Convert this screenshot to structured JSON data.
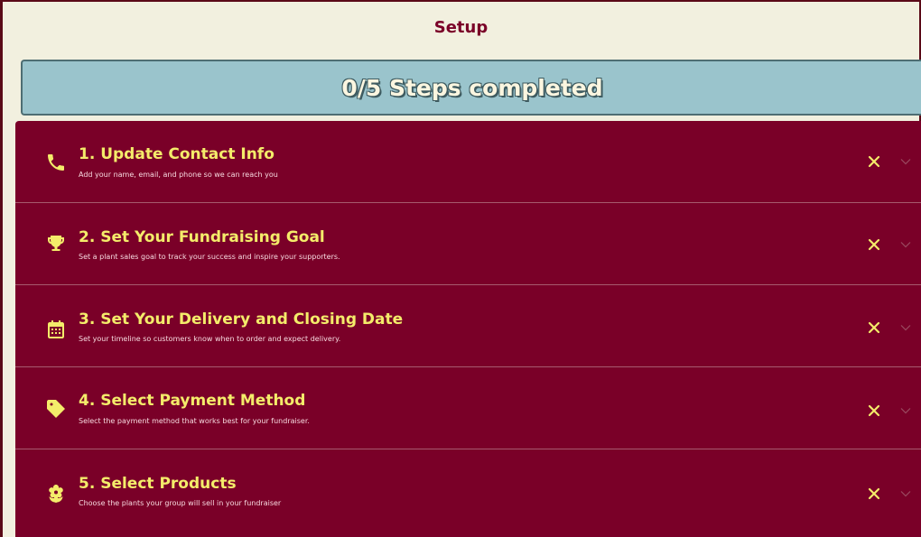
{
  "header": {
    "title": "Setup"
  },
  "progress": {
    "text": "0/5 Steps completed",
    "completed": 0,
    "total": 5
  },
  "steps": [
    {
      "title": "1. Update Contact Info",
      "description": "Add your name, email, and phone so we can reach you",
      "icon": "phone-icon"
    },
    {
      "title": "2. Set Your Fundraising Goal",
      "description": "Set a plant sales goal to track your success and inspire your supporters.",
      "icon": "trophy-icon"
    },
    {
      "title": "3. Set Your Delivery and Closing Date",
      "description": "Set your timeline so customers know when to order and expect delivery.",
      "icon": "calendar-icon"
    },
    {
      "title": "4. Select Payment Method",
      "description": "Select the payment method that works best for your fundraiser.",
      "icon": "tag-icon"
    },
    {
      "title": "5. Select Products",
      "description": "Choose the plants your group will sell in your fundraiser",
      "icon": "flower-icon"
    }
  ],
  "colors": {
    "accent": "#7a0028",
    "title_yellow": "#f4ec6a",
    "progress_bg": "#9ac4cc",
    "page_bg": "#f2f0df"
  }
}
